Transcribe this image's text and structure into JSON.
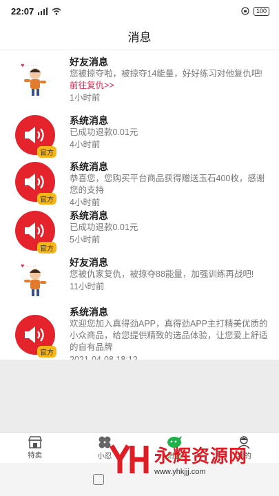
{
  "status": {
    "time": "22:07",
    "battery": "100"
  },
  "header": {
    "title": "消息"
  },
  "messages": [
    {
      "type": "friend",
      "title": "好友消息",
      "body": "您被掠夺啦，被掠夺14能量，好好练习对他复仇吧!",
      "link": "前往复仇>>",
      "time": "1小时前"
    },
    {
      "type": "system",
      "badge": "官方",
      "title": "系统消息",
      "body": "已成功退款0.01元",
      "time": "4小时前"
    },
    {
      "type": "system",
      "badge": "官方",
      "title": "系统消息",
      "body": "恭喜您，您购买平台商品获得赠送玉石400枚，感谢您的支持",
      "time": "4小时前"
    },
    {
      "type": "system",
      "badge": "官方",
      "title": "系统消息",
      "body": "已成功退款0.01元",
      "time": "5小时前"
    },
    {
      "type": "friend",
      "title": "好友消息",
      "body": "您被仇家复仇，被掠夺88能量，加强训练再战吧!",
      "time": "11小时前"
    },
    {
      "type": "system",
      "badge": "官方",
      "title": "系统消息",
      "body": "欢迎您加入真得劲APP，真得劲APP主打精美优质的小众商品，给您提供精致的选品体验，让您爱上舒适的自有品牌",
      "time": "2021-04-08 18:12"
    }
  ],
  "tabs": [
    {
      "label": "特卖",
      "icon": "shop-icon"
    },
    {
      "label": "小忍",
      "icon": "clover-icon"
    },
    {
      "label": "消息",
      "icon": "chat-bird-icon",
      "active": true
    },
    {
      "label": "我的",
      "icon": "person-icon"
    }
  ],
  "watermark": {
    "text": "永辉资源网",
    "url": "www.yhkjjj.com"
  },
  "colors": {
    "accent": "#1db24a",
    "red": "#e5232d",
    "link": "#e2244f"
  }
}
